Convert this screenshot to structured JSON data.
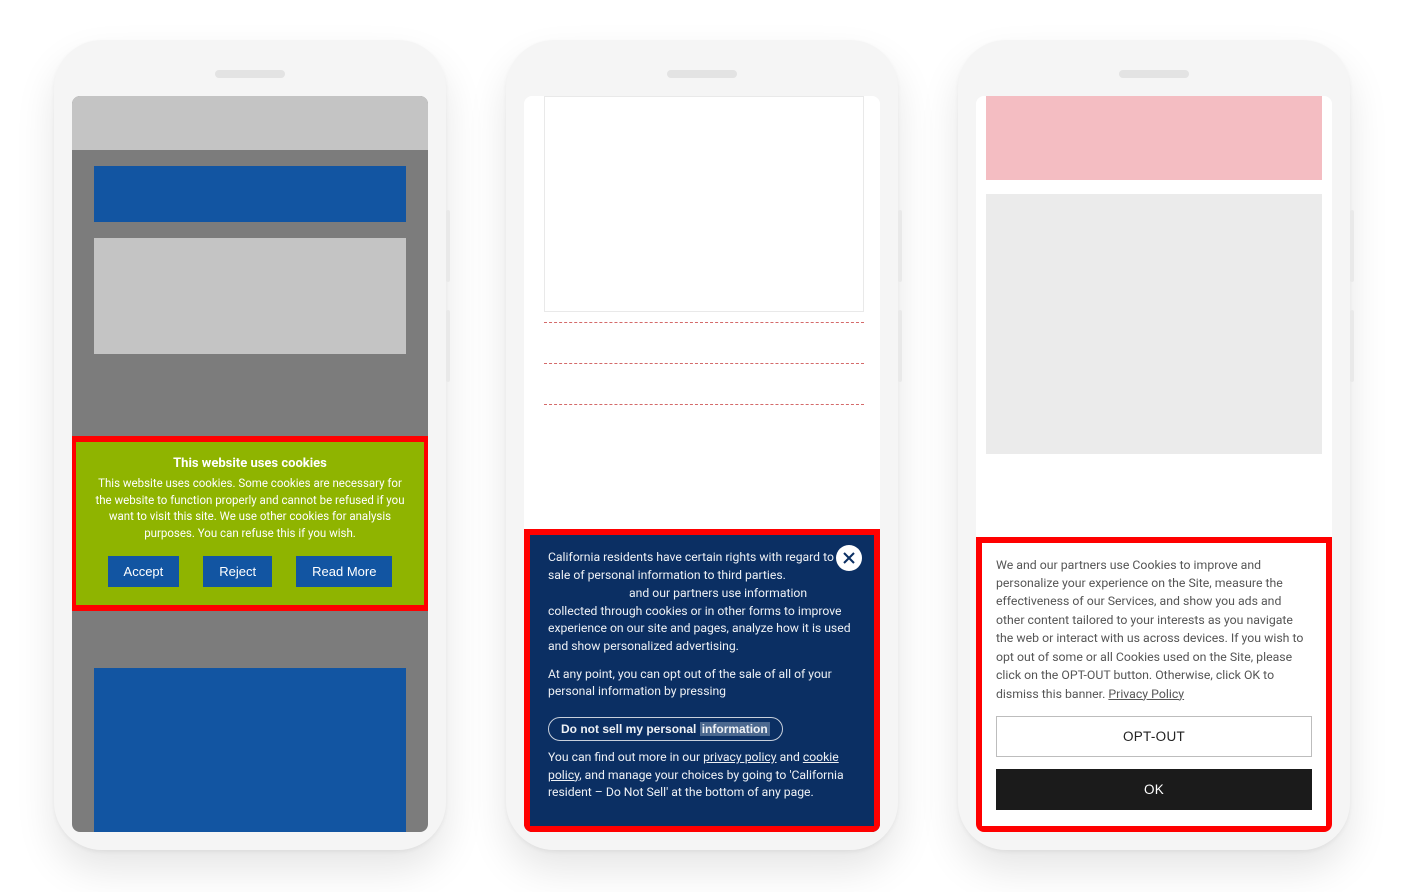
{
  "phone1": {
    "banner": {
      "title": "This website uses cookies",
      "body": "This website uses cookies. Some cookies are necessary for the website to function properly and cannot be refused if you want to visit this site. We use other cookies for analysis purposes. You can refuse this if you wish.",
      "accept": "Accept",
      "reject": "Reject",
      "read_more": "Read More"
    }
  },
  "phone2": {
    "banner": {
      "p1_a": "California residents have certain rights with regard to the sale of personal information to third parties.",
      "p1_b": "and our partners use information collected through cookies or in other forms to improve experience on our site and pages, analyze how it is used and show personalized advertising.",
      "p2": "At any point, you can opt out of the sale of all of your personal information by pressing",
      "dnsmpi_a": "Do not sell my personal ",
      "dnsmpi_b": "information",
      "p3_a": "You can find out more in our ",
      "privacy_policy": "privacy policy",
      "and": " and ",
      "cookie_policy": "cookie policy",
      "p3_b": ", and manage your choices by going to 'California resident – Do Not Sell' at the bottom of any page.",
      "close_aria": "Close"
    }
  },
  "phone3": {
    "banner": {
      "body": "We and our partners use Cookies to improve and personalize your experience on the Site, measure the effectiveness of our Services, and show you ads and other content tailored to your interests as you navigate the web or interact with us across devices. If you wish to opt out of some or all Cookies used on the Site, please click on the OPT-OUT button. Otherwise, click OK to dismiss this banner. ",
      "privacy_policy": "Privacy Policy",
      "opt_out": "OPT-OUT",
      "ok": "OK"
    }
  }
}
